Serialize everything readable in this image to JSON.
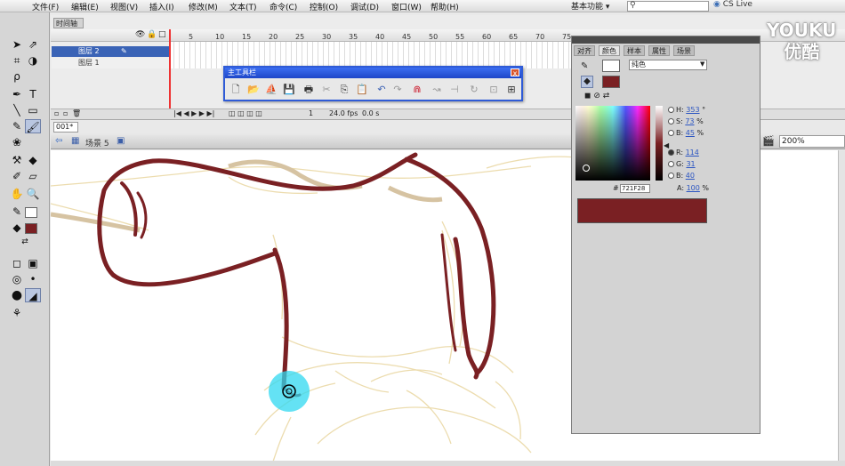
{
  "menu": [
    "文件(F)",
    "编辑(E)",
    "视图(V)",
    "插入(I)",
    "修改(M)",
    "文本(T)",
    "命令(C)",
    "控制(O)",
    "调试(D)",
    "窗口(W)",
    "帮助(H)"
  ],
  "workspace": "基本功能 ▾",
  "search_placeholder": "",
  "cslive": "CS Live",
  "timeline": {
    "tab": "时间轴",
    "frame_numbers": [
      "5",
      "10",
      "15",
      "20",
      "25",
      "30",
      "35",
      "40",
      "45",
      "50",
      "55",
      "60",
      "65",
      "70",
      "75"
    ],
    "layers": [
      {
        "name": "图层 2"
      },
      {
        "name": "图层 1"
      }
    ],
    "status_frame": "1",
    "status_fps": "24.0 fps",
    "status_time": "0.0 s"
  },
  "editbar": {
    "doc_tab": "001*",
    "scene": "场景 5",
    "zoom": "200%"
  },
  "main_toolbar": {
    "title": "主工具栏",
    "close": "x",
    "buttons": [
      "new-icon",
      "open-icon",
      "bridge-icon",
      "save-icon",
      "print-icon",
      "cut-icon",
      "copy-icon",
      "paste-icon",
      "undo-icon",
      "redo-icon",
      "snap-icon",
      "smooth-icon",
      "straighten-icon",
      "rotate-icon",
      "scale-icon",
      "align-icon"
    ]
  },
  "color_panel": {
    "tabs": [
      "对齐",
      "颜色",
      "样本",
      "属性",
      "场景"
    ],
    "active_tab": 1,
    "type": "纯色",
    "hsb": [
      {
        "label": "H:",
        "value": "353",
        "unit": "°"
      },
      {
        "label": "S:",
        "value": "73",
        "unit": "%"
      },
      {
        "label": "B:",
        "value": "45",
        "unit": "%"
      }
    ],
    "rgb": [
      {
        "label": "R:",
        "value": "114"
      },
      {
        "label": "G:",
        "value": "31"
      },
      {
        "label": "B:",
        "value": "40"
      }
    ],
    "alpha_label": "A:",
    "alpha_value": "100",
    "alpha_unit": "%",
    "hex": "721F28",
    "stroke_color": "#ffffff",
    "fill_color": "#7a2023"
  },
  "watermark": [
    "YOUKU",
    "优酷"
  ]
}
